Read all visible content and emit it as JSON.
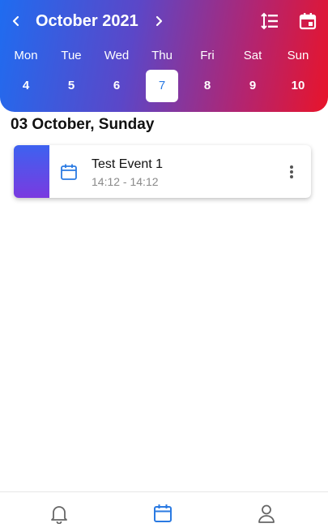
{
  "header": {
    "month_title": "October 2021",
    "prev_icon": "chevron-left-icon",
    "next_icon": "chevron-right-icon",
    "list_view_icon": "sort-lines-icon",
    "calendar_view_icon": "calendar-icon"
  },
  "week": {
    "days": [
      {
        "name": "Mon",
        "date": "4"
      },
      {
        "name": "Tue",
        "date": "5"
      },
      {
        "name": "Wed",
        "date": "6"
      },
      {
        "name": "Thu",
        "date": "7"
      },
      {
        "name": "Fri",
        "date": "8"
      },
      {
        "name": "Sat",
        "date": "9"
      },
      {
        "name": "Sun",
        "date": "10"
      }
    ],
    "selected_date": "7"
  },
  "section": {
    "title": "03 October, Sunday"
  },
  "events": [
    {
      "title": "Test Event 1",
      "time": "14:12 - 14:12",
      "icon": "calendar-icon"
    }
  ],
  "bottom_nav": {
    "items": [
      "bell-icon",
      "calendar-icon",
      "person-icon"
    ],
    "active": "calendar-icon"
  },
  "colors": {
    "gradient_start": "#1f6cf0",
    "gradient_end": "#e8142a",
    "accent": "#2a7ae2",
    "stripe_start": "#3d62f0",
    "stripe_end": "#7a3ae0"
  }
}
